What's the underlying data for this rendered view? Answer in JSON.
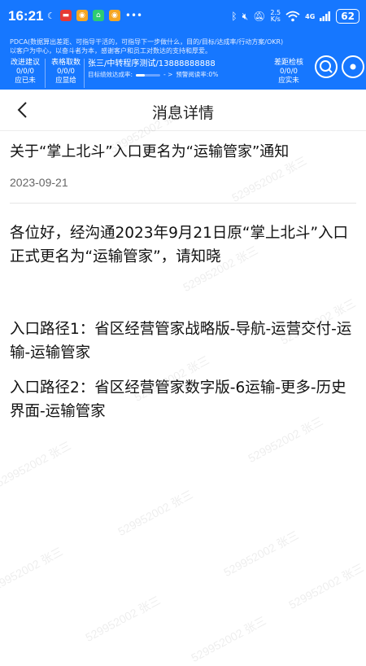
{
  "status_bar": {
    "time": "16:21",
    "network_speed_value": "2.5",
    "network_speed_unit": "K/s",
    "signal_label": "4G",
    "battery": "62"
  },
  "pdca_banner": {
    "line1": "PDCA(数据算出差距、可指导干活的，可指导下一步做什么，目的/目标/达成率/行动方案/OKR)",
    "line2": "以客户为中心，以奋斗者为本，感谢客户和员工对数达的支持和厚爱。",
    "boxes": [
      {
        "title": "改进建议",
        "value": "0/0/0",
        "sub": "应已未"
      },
      {
        "title": "表格取数",
        "value": "0/0/0",
        "sub": "应显给"
      },
      {
        "title": "差距检核",
        "value": "0/0/0",
        "sub": "应实未"
      }
    ],
    "user": "张三/中转程序测试/13888888888",
    "goal_label": "目标绩效达成率:",
    "goal_progress": 0.35,
    "arrows": "- >",
    "preview_label": "预警阅读率:0%"
  },
  "nav": {
    "title": "消息详情"
  },
  "message": {
    "title": "关于“掌上北斗”入口更名为“运输管家”通知",
    "date": "2023-09-21",
    "paragraph1": "各位好，经沟通2023年9月21日原“掌上北斗”入口正式更名为“运输管家”，请知晓",
    "paragraph2": "入口路径1：省区经营管家战略版-导航-运营交付-运输-运输管家",
    "paragraph3": "入口路径2：省区经营管家数字版-6运输-更多-历史界面-运输管家"
  },
  "watermark_text": "529952002 张三",
  "colors": {
    "brand_blue": "#1677ff",
    "text": "#111111",
    "date": "#666666"
  }
}
